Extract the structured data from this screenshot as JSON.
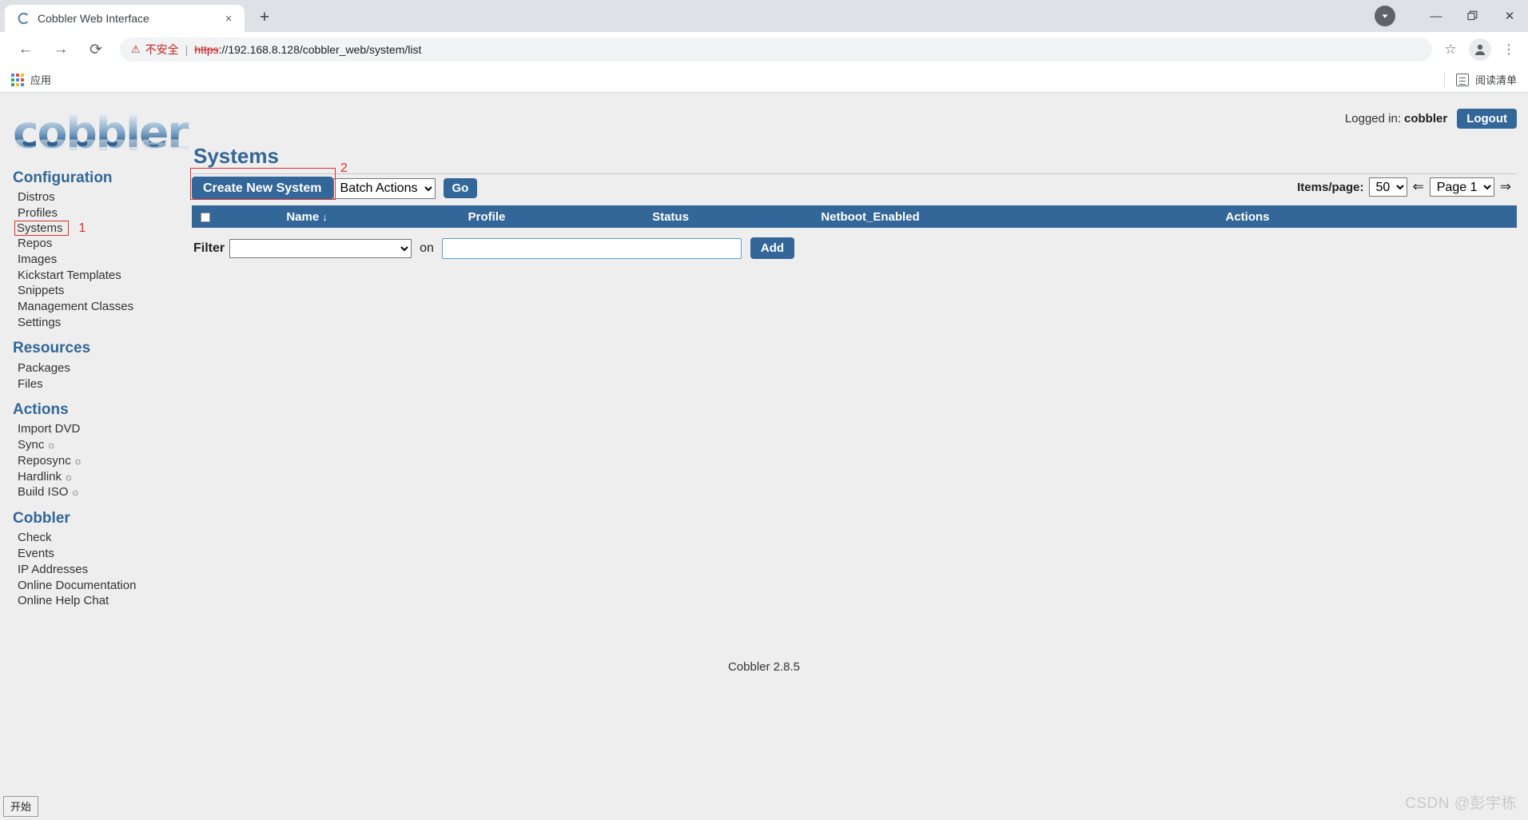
{
  "browser": {
    "tab": {
      "title": "Cobbler Web Interface",
      "favicon": "cobbler-c-icon",
      "close": "×"
    },
    "new_tab_label": "+",
    "window_controls": {
      "download": "download-icon",
      "minimize": "—",
      "restore": "❐",
      "close": "✕"
    },
    "nav": {
      "back": "←",
      "forward": "→",
      "reload": "⟳"
    },
    "omnibox": {
      "warning_icon": "⚠",
      "warning_text": "不安全",
      "separator": "|",
      "url_scheme": "https",
      "url_rest": "://192.168.8.128/cobbler_web/system/list"
    },
    "star_icon": "☆",
    "avatar_icon": "profile-icon",
    "menu_icon": "⋮",
    "bookmarks": {
      "apps_label": "应用",
      "reading_list_label": "阅读清单"
    }
  },
  "header": {
    "logo_text": "cobbler",
    "logged_in_label": "Logged in:",
    "username": "cobbler",
    "logout_label": "Logout"
  },
  "sidebar": {
    "sections": [
      {
        "title": "Configuration",
        "items": [
          {
            "label": "Distros"
          },
          {
            "label": "Profiles"
          },
          {
            "label": "Systems",
            "highlighted": true,
            "annotation": "1"
          },
          {
            "label": "Repos"
          },
          {
            "label": "Images"
          },
          {
            "label": "Kickstart Templates"
          },
          {
            "label": "Snippets"
          },
          {
            "label": "Management Classes"
          },
          {
            "label": "Settings"
          }
        ]
      },
      {
        "title": "Resources",
        "items": [
          {
            "label": "Packages"
          },
          {
            "label": "Files"
          }
        ]
      },
      {
        "title": "Actions",
        "items": [
          {
            "label": "Import DVD"
          },
          {
            "label": "Sync",
            "icon": "☼"
          },
          {
            "label": "Reposync",
            "icon": "☼"
          },
          {
            "label": "Hardlink",
            "icon": "☼"
          },
          {
            "label": "Build ISO",
            "icon": "☼"
          }
        ]
      },
      {
        "title": "Cobbler",
        "items": [
          {
            "label": "Check"
          },
          {
            "label": "Events"
          },
          {
            "label": "IP Addresses"
          },
          {
            "label": "Online Documentation"
          },
          {
            "label": "Online Help Chat"
          }
        ]
      }
    ]
  },
  "main": {
    "title": "Systems",
    "create_button": "Create New System",
    "create_button_annotation": "2",
    "batch_actions_value": "Batch Actions",
    "go_button": "Go",
    "pager": {
      "items_per_page_label": "Items/page:",
      "items_per_page_value": "50",
      "prev_arrow": "⇐",
      "page_value": "Page 1",
      "next_arrow": "⇒"
    },
    "table": {
      "columns": [
        "",
        "Name",
        "Profile",
        "Status",
        "Netboot_Enabled",
        "Actions"
      ],
      "sort_indicator": "↓",
      "rows": []
    },
    "filter": {
      "label": "Filter",
      "select_value": "",
      "on_label": "on",
      "input_value": "",
      "add_button": "Add"
    }
  },
  "footer": {
    "version": "Cobbler 2.8.5"
  },
  "overlay": {
    "watermark": "CSDN @彭宇栋",
    "taskbar_start": "开始"
  },
  "colors": {
    "brand_blue": "#336699",
    "annotation_red": "#e03030",
    "page_bg": "#eeeeee"
  }
}
